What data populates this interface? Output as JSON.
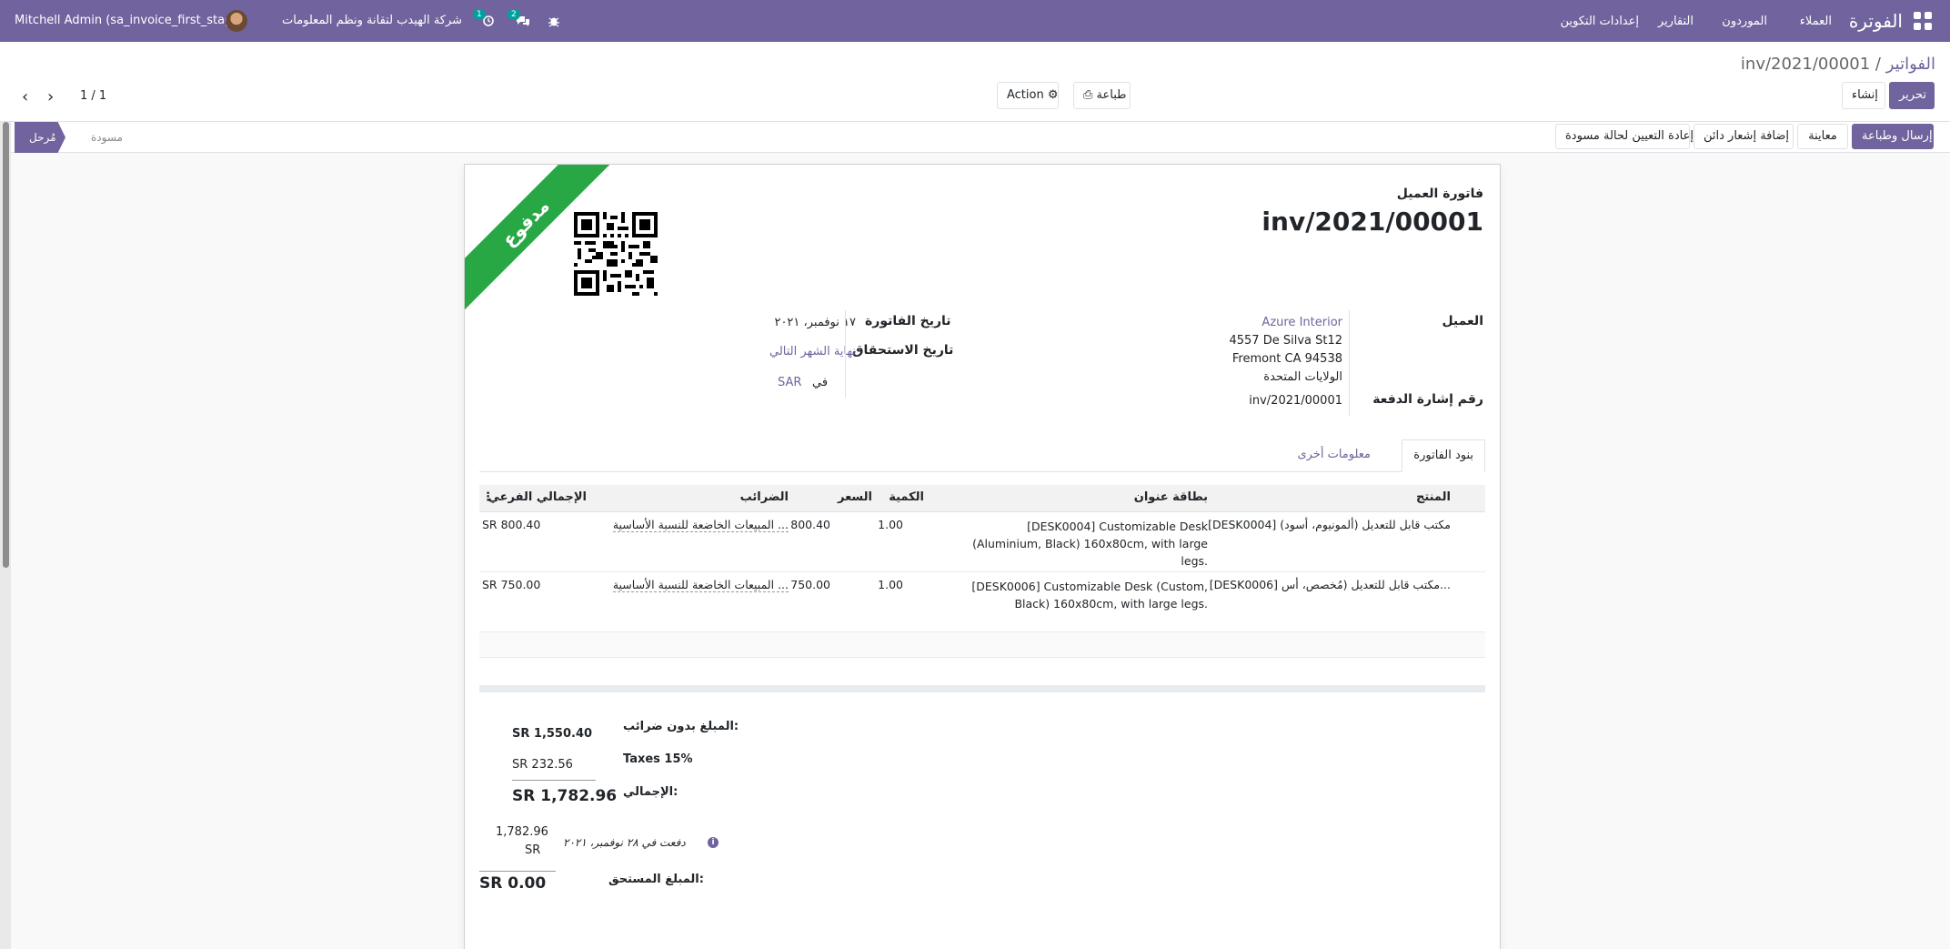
{
  "navbar": {
    "app_title": "الفوترة",
    "menu": [
      "العملاء",
      "الموردون",
      "التقارير",
      "إعدادات التكوين"
    ],
    "company": "شركة الهيدب لتقانة ونظم المعلومات",
    "user": "Mitchell Admin (sa_invoice_first_stage)",
    "activity_badge": "1",
    "messages_badge": "2"
  },
  "breadcrumb": {
    "parent": "الفواتير",
    "separator": "/",
    "current": "inv/2021/00001"
  },
  "buttons": {
    "edit": "تحرير",
    "create": "إنشاء",
    "print": "طباعة",
    "action": "Action"
  },
  "pager": {
    "value": "1 / 1"
  },
  "statusbar": {
    "send_print": "إرسال وطباعة",
    "preview": "معاينة",
    "add_credit_note": "إضافة إشعار دائن",
    "reset_to_draft": "إعادة التعيين لحالة مسودة",
    "stage_posted": "مُرحل",
    "stage_draft": "مسودة"
  },
  "invoice": {
    "ribbon": "مدفوع",
    "type": "فاتورة العميل",
    "name": "inv/2021/00001",
    "customer_label": "العميل",
    "customer_name": "Azure Interior",
    "address_1": "4557 De Silva St12",
    "address_2": "Fremont CA 94538",
    "address_3": "الولايات المتحدة",
    "payment_ref_label": "رقم إشارة الدفعة",
    "payment_ref": "inv/2021/00001",
    "invoice_date_label": "تاريخ الفاتورة",
    "invoice_date": "١٧ نوفمبر، ٢٠٢١",
    "due_date_label": "تاريخ الاستحقاق",
    "due_date": "نهاية الشهر التالي",
    "currency_in": "في",
    "currency": "SAR"
  },
  "tabs": {
    "lines": "بنود الفاتورة",
    "other": "معلومات أخرى"
  },
  "table": {
    "headers": {
      "product": "المنتج",
      "label": "بطاقة عنوان",
      "quantity": "الكمية",
      "price": "السعر",
      "taxes": "الضرائب",
      "subtotal": "الإجمالي الفرعي"
    },
    "rows": [
      {
        "product": "[DESK0004] مكتب قابل للتعديل (ألمونيوم، أسود)",
        "label": "[DESK0004] Customizable Desk (Aluminium, Black) 160x80cm, with large legs.",
        "quantity": "1.00",
        "price": "800.40",
        "taxes": "المبيعات الخاضعة للنسبة الأساسية ...",
        "subtotal": "SR 800.40"
      },
      {
        "product": "[DESK0006] مكتب قابل للتعديل (مُخصص، أس...",
        "label": "[DESK0006] Customizable Desk (Custom, Black) 160x80cm, with large legs.",
        "quantity": "1.00",
        "price": "750.00",
        "taxes": "المبيعات الخاضعة للنسبة الأساسية ...",
        "subtotal": "SR 750.00"
      }
    ]
  },
  "totals": {
    "untaxed_label": "المبلغ بدون ضرائب:",
    "untaxed": "SR 1,550.40",
    "tax_label": "Taxes 15%",
    "tax": "SR 232.56",
    "total_label": "الإجمالي:",
    "total": "SR 1,782.96",
    "paid_on": "دفعت في ٢٨ نوفمبر، ٢٠٢١",
    "paid_amount_1": "1,782.96",
    "paid_amount_2": "SR",
    "due_label": "المبلغ المستحق:",
    "due": "SR 0.00"
  }
}
